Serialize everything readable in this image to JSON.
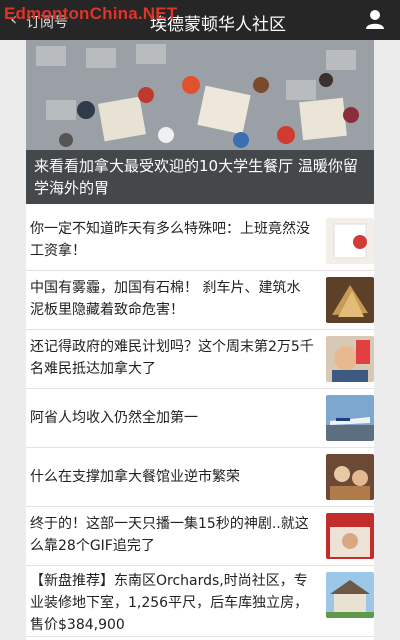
{
  "watermark": "EdmontonChina.NET",
  "header": {
    "back_label": "订阅号",
    "title": "埃德蒙顿华人社区"
  },
  "hero": {
    "title": "来看看加拿大最受欢迎的10大学生餐厅 温暖你留学海外的胃"
  },
  "articles": [
    {
      "title": "你一定不知道昨天有多么特殊吧：上班竟然没工资拿！"
    },
    {
      "title": "中国有雾霾，加国有石棉！ 刹车片、建筑水泥板里隐藏着致命危害！"
    },
    {
      "title": "还记得政府的难民计划吗？这个周末第2万5千名难民抵达加拿大了"
    },
    {
      "title": "阿省人均收入仍然全加第一"
    },
    {
      "title": "什么在支撑加拿大餐馆业逆市繁荣"
    },
    {
      "title": "终于的！这部一天只播一集15秒的神剧..就这么靠28个GIF追完了"
    },
    {
      "title": "【新盘推荐】东南区Orchards,时尚社区，专业装修地下室，1,256平尺，后车库独立房，售价$384,900"
    }
  ],
  "colors": {
    "topbar": "#262626",
    "watermark": "#e0332a"
  }
}
